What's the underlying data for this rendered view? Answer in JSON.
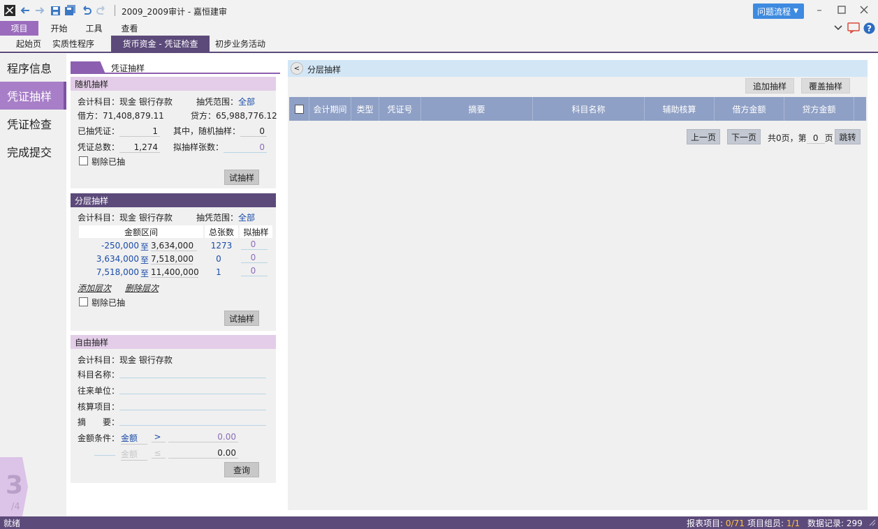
{
  "window": {
    "title": "2009_2009审计 - 嘉恒建审",
    "help_flow": "问题流程"
  },
  "menu": {
    "items": [
      "项目",
      "开始",
      "工具",
      "查看"
    ]
  },
  "tabs": [
    "起始页",
    "实质性程序",
    "货币资金 - 凭证检查",
    "初步业务活动"
  ],
  "leftnav": {
    "items": [
      "程序信息",
      "凭证抽样",
      "凭证检查",
      "完成提交"
    ],
    "step": "3",
    "total": "/4"
  },
  "mid": {
    "tab_label": "凭证抽样",
    "random": {
      "title": "随机抽样",
      "account_label": "会计科目：现金 银行存款",
      "range_label": "抽凭范围：",
      "range_value": "全部",
      "debit": "借方：71,408,879.11",
      "credit": "贷方：65,988,776.12",
      "drawn_label": "已抽凭证：",
      "drawn_value": "1",
      "random_label": "其中，随机抽样：",
      "random_value": "0",
      "total_label": "凭证总数：",
      "total_value": "1,274",
      "planned_label": "拟抽样张数：",
      "planned_value": "0",
      "exclude_label": "剔除已抽",
      "try_button": "试抽样"
    },
    "stratified": {
      "title": "分层抽样",
      "account_label": "会计科目：现金 银行存款",
      "range_label": "抽凭范围：",
      "range_value": "全部",
      "headers": [
        "金额区间",
        "总张数",
        "拟抽样"
      ],
      "rows": [
        {
          "from": "-250,000",
          "to_label": "至",
          "to": "3,634,000",
          "count": "1273",
          "planned": "0"
        },
        {
          "from": "3,634,000",
          "to_label": "至",
          "to": "7,518,000",
          "count": "0",
          "planned": "0"
        },
        {
          "from": "7,518,000",
          "to_label": "至",
          "to": "11,400,000",
          "count": "1",
          "planned": "0"
        }
      ],
      "add_layer": "添加层次",
      "delete_layer": "删除层次",
      "exclude_label": "剔除已抽",
      "try_button": "试抽样"
    },
    "free": {
      "title": "自由抽样",
      "account_label": "会计科目：现金 银行存款",
      "subject_label": "科目名称：",
      "partner_label": "往来单位：",
      "item_label": "核算项目：",
      "summary_label": "摘　　要：",
      "amount_label": "金额条件：",
      "amount_field": "金额",
      "op1": ">",
      "value1": "0.00",
      "amount_field2": "金额",
      "op2": "≤",
      "value2": "0.00",
      "query_button": "查询"
    }
  },
  "right": {
    "title": "分层抽样",
    "collapse": "<",
    "append_button": "追加抽样",
    "override_button": "覆盖抽样",
    "columns": [
      "会计期间",
      "类型",
      "凭证号",
      "摘要",
      "科目名称",
      "辅助核算",
      "借方金额",
      "贷方金额"
    ],
    "pager": {
      "prev": "上一页",
      "next": "下一页",
      "info_prefix": "共0页，第",
      "page": "0",
      "info_suffix": "页",
      "jump": "跳转"
    }
  },
  "status": {
    "left": "就绪",
    "report_label": "报表项目:",
    "report_value": "0/71",
    "group_label": "项目组员:",
    "group_value": "1/1",
    "records_label": "数据记录:",
    "records_value": "299"
  },
  "colors": {
    "purple_dark": "#5c4a7a",
    "purple_accent": "#9b6cbd",
    "blue_button": "#3d8ae0",
    "grid_header": "#8fa0c6"
  }
}
